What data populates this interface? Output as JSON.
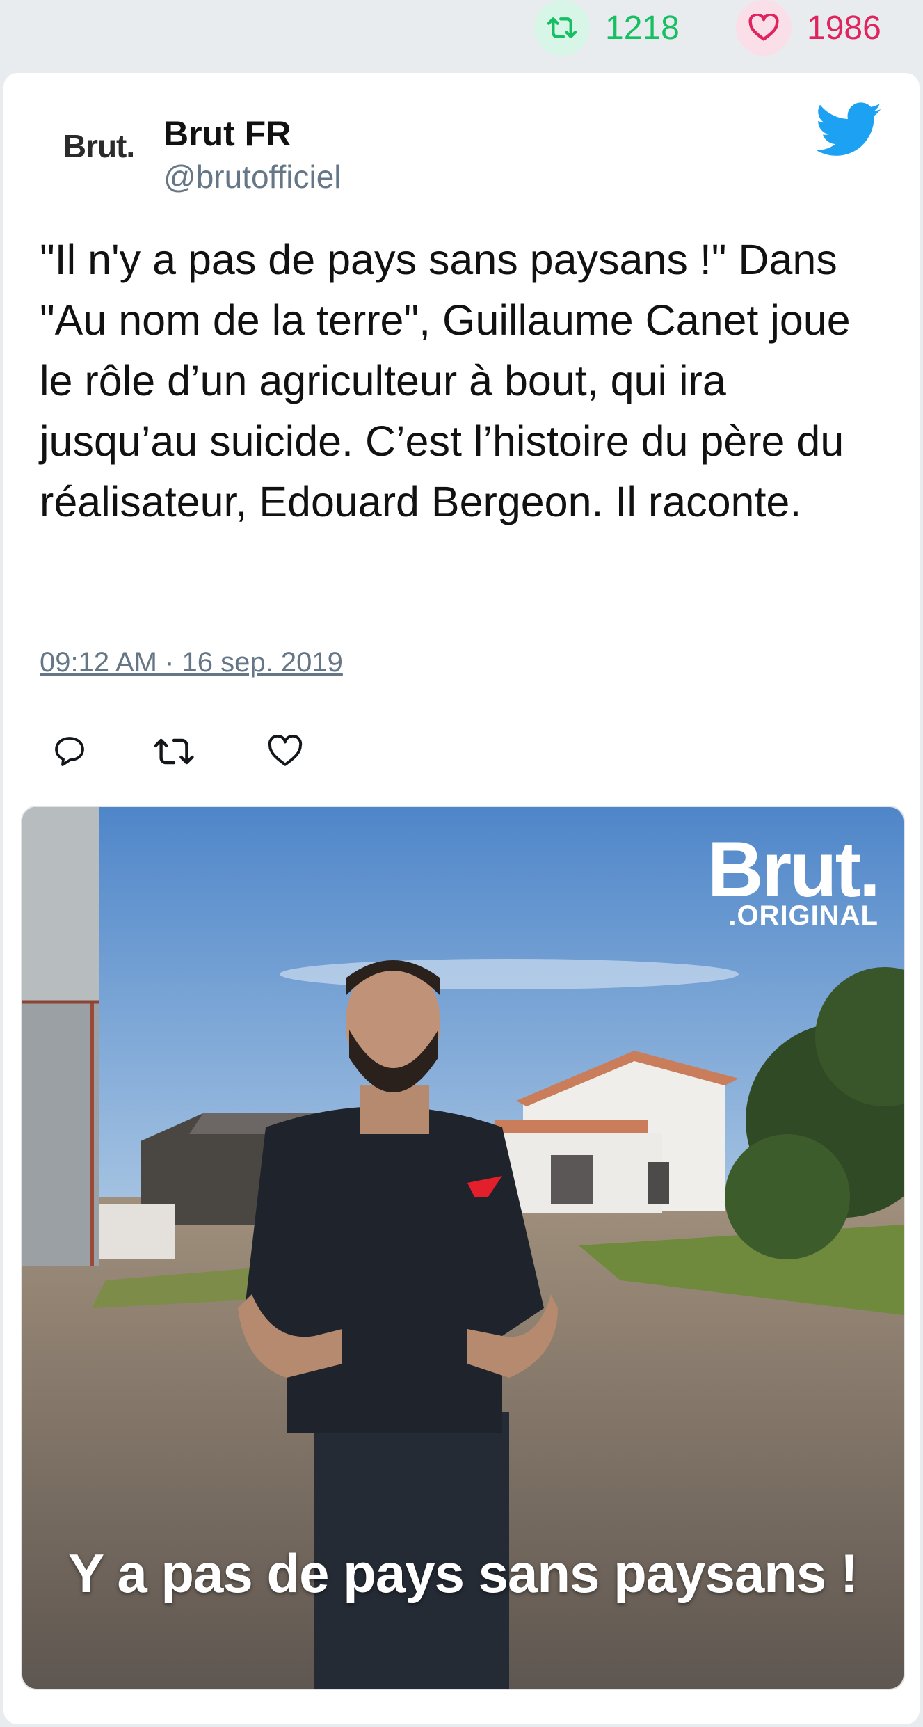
{
  "stats": {
    "retweets": "1218",
    "likes": "1986",
    "retweet_color": "#17bf63",
    "like_color": "#e0245e"
  },
  "tweet": {
    "avatar_text": "Brut.",
    "name": "Brut FR",
    "handle": "@brutofficiel",
    "text": "\"Il n'y a pas de pays sans paysans !\" Dans \"Au nom de la terre\", Guillaume Canet joue le rôle d’un agriculteur à bout, qui ira jusqu’au suicide. C’est l’histoire du père du réalisateur, Edouard Bergeon. Il raconte.",
    "timestamp": "09:12 AM · 16 sep. 2019",
    "brand_color": "#1da1f2"
  },
  "actions": {
    "icons": [
      "reply-icon",
      "retweet-icon",
      "like-icon"
    ]
  },
  "media": {
    "logo_main": "Brut.",
    "logo_sub": ".ORIGINAL",
    "caption": "Y a pas de pays sans paysans !"
  }
}
